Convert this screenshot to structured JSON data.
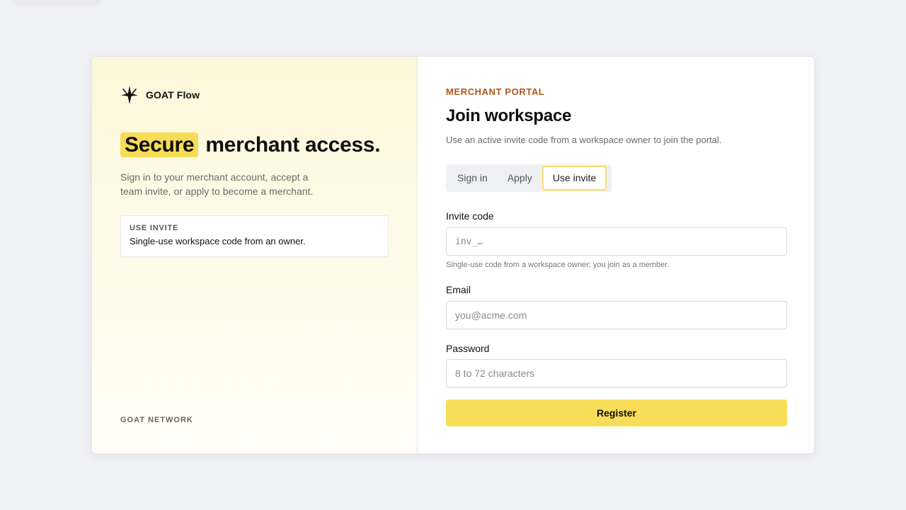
{
  "brand": {
    "name": "GOAT Flow",
    "icon": "sparkle-star-icon"
  },
  "hero": {
    "headline_highlight": "Secure",
    "headline_rest": "merchant access.",
    "subtext": "Sign in to your merchant account, accept a team invite, or apply to become a merchant.",
    "info_box": {
      "label": "USE INVITE",
      "description": "Single-use workspace code from an owner."
    },
    "footer": "GOAT NETWORK"
  },
  "form": {
    "eyebrow": "MERCHANT PORTAL",
    "title": "Join workspace",
    "description": "Use an active invite code from a workspace owner to join the portal.",
    "tabs": [
      {
        "label": "Sign in",
        "active": false
      },
      {
        "label": "Apply",
        "active": false
      },
      {
        "label": "Use invite",
        "active": true
      }
    ],
    "invite": {
      "label": "Invite code",
      "placeholder": "inv_…",
      "value": "",
      "hint": "Single-use code from a workspace owner; you join as a member."
    },
    "email": {
      "label": "Email",
      "placeholder": "you@acme.com",
      "value": ""
    },
    "password": {
      "label": "Password",
      "placeholder": "8 to 72 characters",
      "value": ""
    },
    "submit_label": "Register"
  },
  "colors": {
    "accent": "#f8dd58",
    "eyebrow": "#b0561e",
    "background": "#f0f1f4"
  }
}
